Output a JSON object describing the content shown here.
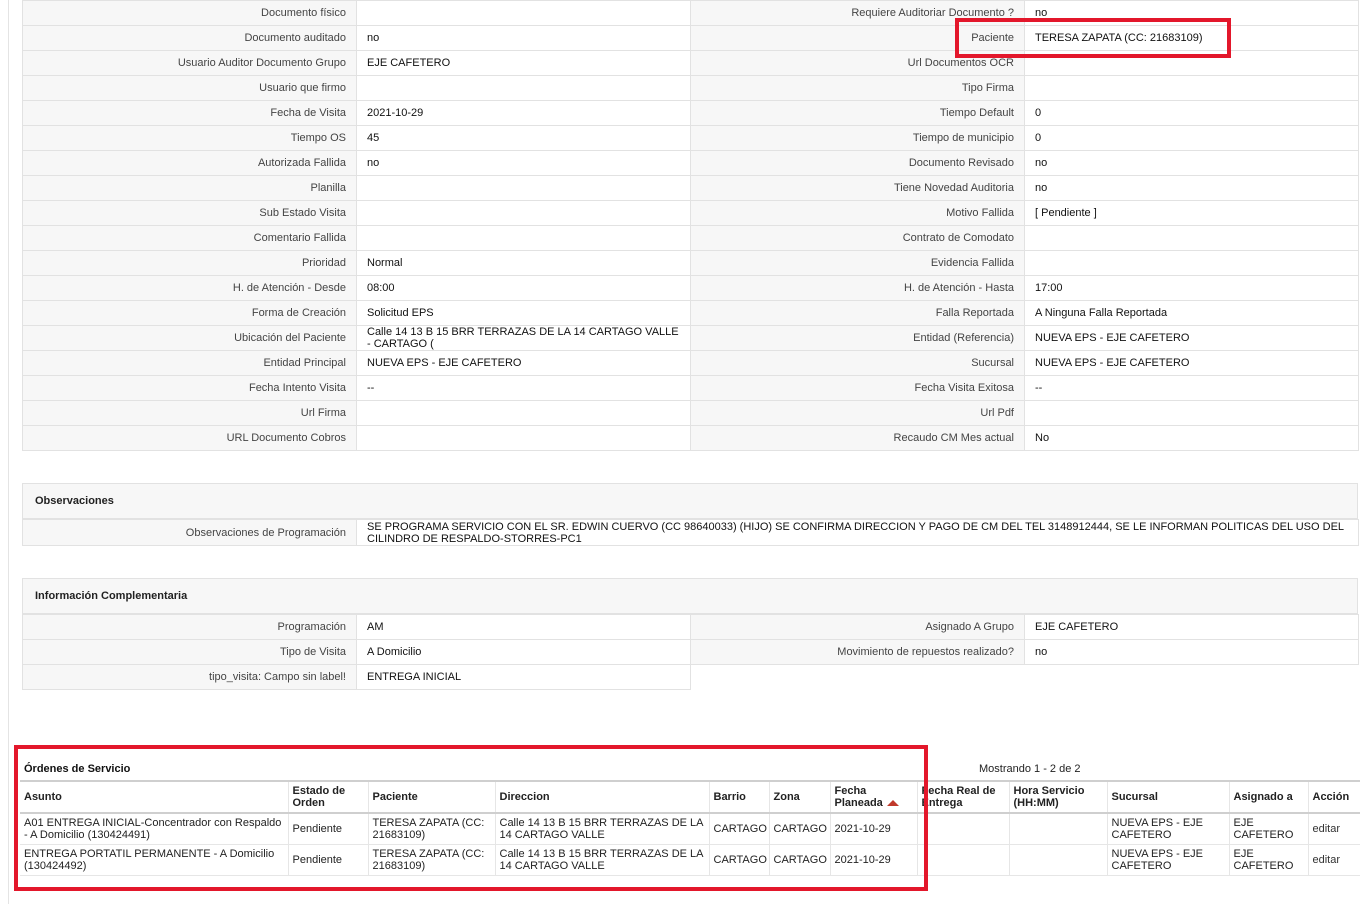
{
  "fields": {
    "left": [
      {
        "label": "Documento físico",
        "value": ""
      },
      {
        "label": "Documento auditado",
        "value": "no"
      },
      {
        "label": "Usuario Auditor Documento Grupo",
        "value": "EJE CAFETERO"
      },
      {
        "label": "Usuario que firmo",
        "value": ""
      },
      {
        "label": "Fecha de Visita",
        "value": "2021-10-29"
      },
      {
        "label": "Tiempo OS",
        "value": "45"
      },
      {
        "label": "Autorizada Fallida",
        "value": "no"
      },
      {
        "label": "Planilla",
        "value": ""
      },
      {
        "label": "Sub Estado Visita",
        "value": ""
      },
      {
        "label": "Comentario Fallida",
        "value": ""
      },
      {
        "label": "Prioridad",
        "value": "Normal"
      },
      {
        "label": "H. de Atención - Desde",
        "value": "08:00"
      },
      {
        "label": "Forma de Creación",
        "value": "Solicitud EPS"
      },
      {
        "label": "Ubicación del Paciente",
        "value": "Calle 14 13 B 15 BRR TERRAZAS DE LA 14 CARTAGO VALLE - CARTAGO ("
      },
      {
        "label": "Entidad Principal",
        "value": "NUEVA EPS - EJE CAFETERO"
      },
      {
        "label": "Fecha Intento Visita",
        "value": "--"
      },
      {
        "label": "Url Firma",
        "value": ""
      },
      {
        "label": "URL Documento Cobros",
        "value": ""
      }
    ],
    "right": [
      {
        "label": "Requiere Auditoriar Documento ?",
        "value": "no"
      },
      {
        "label": "Paciente",
        "value": "TERESA ZAPATA (CC: 21683109)"
      },
      {
        "label": "Url Documentos OCR",
        "value": ""
      },
      {
        "label": "Tipo Firma",
        "value": ""
      },
      {
        "label": "Tiempo Default",
        "value": "0"
      },
      {
        "label": "Tiempo de municipio",
        "value": "0"
      },
      {
        "label": "Documento Revisado",
        "value": "no"
      },
      {
        "label": "Tiene Novedad Auditoria",
        "value": "no"
      },
      {
        "label": "Motivo Fallida",
        "value": "[ Pendiente ]"
      },
      {
        "label": "Contrato de Comodato",
        "value": ""
      },
      {
        "label": "Evidencia Fallida",
        "value": ""
      },
      {
        "label": "H. de Atención - Hasta",
        "value": "17:00"
      },
      {
        "label": "Falla Reportada",
        "value": "A Ninguna Falla Reportada"
      },
      {
        "label": "Entidad (Referencia)",
        "value": "NUEVA EPS - EJE CAFETERO"
      },
      {
        "label": "Sucursal",
        "value": "NUEVA EPS - EJE CAFETERO"
      },
      {
        "label": "Fecha Visita Exitosa",
        "value": "--"
      },
      {
        "label": "Url Pdf",
        "value": ""
      },
      {
        "label": "Recaudo CM Mes actual",
        "value": "No"
      }
    ]
  },
  "observaciones": {
    "title": "Observaciones",
    "label": "Observaciones de Programación",
    "value": "SE PROGRAMA SERVICIO CON EL SR. EDWIN CUERVO (CC 98640033) (HIJO) SE CONFIRMA DIRECCION Y PAGO DE CM DEL TEL 3148912444, SE LE INFORMAN POLITICAS DEL USO DEL CILINDRO DE RESPALDO-STORRES-PC1"
  },
  "complementaria": {
    "title": "Información Complementaria",
    "left": [
      {
        "label": "Programación",
        "value": "AM"
      },
      {
        "label": "Tipo de Visita",
        "value": "A Domicilio"
      },
      {
        "label": "tipo_visita: Campo sin label!",
        "value": "ENTREGA INICIAL"
      }
    ],
    "right": [
      {
        "label": "Asignado A Grupo",
        "value": "EJE CAFETERO"
      },
      {
        "label": "Movimiento de repuestos realizado?",
        "value": "no"
      }
    ]
  },
  "ordenes": {
    "title": "Órdenes de Servicio",
    "showing": "Mostrando 1 - 2 de 2",
    "columns": [
      "Asunto",
      "Estado de Orden",
      "Paciente",
      "Direccion",
      "Barrio",
      "Zona",
      "Fecha Planeada",
      "Fecha Real de Entrega",
      "Hora Servicio (HH:MM)",
      "Sucursal",
      "Asignado a",
      "Acción"
    ],
    "rows": [
      {
        "asunto": "A01 ENTREGA INICIAL-Concentrador con Respaldo - A Domicilio (130424491)",
        "estado": "Pendiente",
        "paciente": "TERESA ZAPATA (CC: 21683109)",
        "direccion": "Calle 14 13 B 15 BRR TERRAZAS DE LA 14 CARTAGO VALLE",
        "barrio": "CARTAGO",
        "zona": "CARTAGO",
        "fecha_planeada": "2021-10-29",
        "fecha_real": "",
        "hora": "",
        "sucursal": "NUEVA EPS - EJE CAFETERO",
        "asignado": "EJE CAFETERO",
        "accion": "editar"
      },
      {
        "asunto": "ENTREGA PORTATIL PERMANENTE - A Domicilio (130424492)",
        "estado": "Pendiente",
        "paciente": "TERESA ZAPATA (CC: 21683109)",
        "direccion": "Calle 14 13 B 15 BRR TERRAZAS DE LA 14 CARTAGO VALLE",
        "barrio": "CARTAGO",
        "zona": "CARTAGO",
        "fecha_planeada": "2021-10-29",
        "fecha_real": "",
        "hora": "",
        "sucursal": "NUEVA EPS - EJE CAFETERO",
        "asignado": "EJE CAFETERO",
        "accion": "editar"
      }
    ]
  }
}
